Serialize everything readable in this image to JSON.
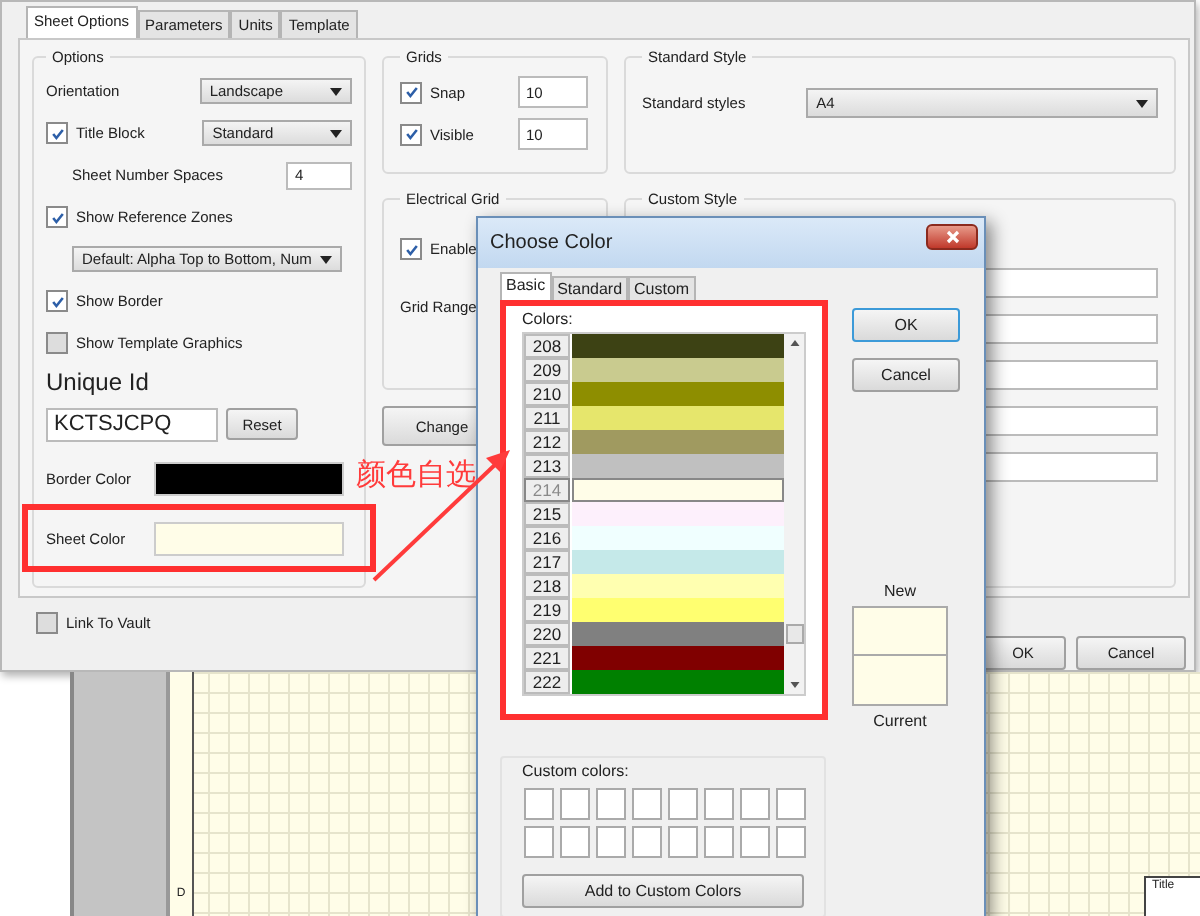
{
  "main_dialog": {
    "tabs": [
      {
        "label": "Sheet Options",
        "selected": true
      },
      {
        "label": "Parameters",
        "selected": false
      },
      {
        "label": "Units",
        "selected": false
      },
      {
        "label": "Template",
        "selected": false
      }
    ],
    "options": {
      "title": "Options",
      "items": [
        {
          "kind": "dropdown",
          "label": "Orientation",
          "value": "Landscape"
        },
        {
          "kind": "check-dropdown",
          "label": "Title Block",
          "checked": true,
          "value": "Standard"
        },
        {
          "kind": "number",
          "label": "Sheet Number Spaces",
          "value": "4"
        },
        {
          "kind": "checkbox",
          "label": "Show Reference Zones",
          "checked": true
        },
        {
          "kind": "select",
          "value": "Default: Alpha Top to Bottom, Num"
        },
        {
          "kind": "checkbox",
          "label": "Show Border",
          "checked": true
        },
        {
          "kind": "checkbox",
          "label": "Show Template Graphics",
          "checked": false
        },
        {
          "kind": "heading",
          "label": "Unique Id"
        },
        {
          "kind": "id",
          "value": "KCTSJCPQ",
          "button": "Reset"
        },
        {
          "kind": "color",
          "label": "Border Color",
          "color": "#000000",
          "highlighted": false
        },
        {
          "kind": "color",
          "label": "Sheet Color",
          "color": "#fffde8",
          "highlighted": true
        }
      ]
    },
    "grids": {
      "title": "Grids",
      "items": [
        {
          "label": "Snap",
          "checked": true,
          "value": "10"
        },
        {
          "label": "Visible",
          "checked": true,
          "value": "10"
        }
      ]
    },
    "electrical_grid": {
      "title": "Electrical Grid",
      "enable": {
        "label": "Enable",
        "checked": true
      },
      "range_label": "Grid Range"
    },
    "change_button": "Change",
    "standard_style": {
      "title": "Standard Style",
      "label": "Standard styles",
      "value": "A4"
    },
    "custom_style": {
      "title": "Custom Style"
    },
    "link_to_vault": {
      "label": "Link To Vault",
      "checked": false
    },
    "buttons": [
      "OK",
      "Cancel"
    ]
  },
  "color_dialog": {
    "title": "Choose Color",
    "tabs": [
      {
        "label": "Basic",
        "selected": true
      },
      {
        "label": "Standard",
        "selected": false
      },
      {
        "label": "Custom",
        "selected": false
      }
    ],
    "colors_label": "Colors:",
    "highlighted": true,
    "colors": [
      {
        "number": "208",
        "color": "#3d4214",
        "selected": false
      },
      {
        "number": "209",
        "color": "#c9cb8f",
        "selected": false
      },
      {
        "number": "210",
        "color": "#8e8e00",
        "selected": false
      },
      {
        "number": "211",
        "color": "#e6e66c",
        "selected": false
      },
      {
        "number": "212",
        "color": "#a09a60",
        "selected": false
      },
      {
        "number": "213",
        "color": "#c0c0c0",
        "selected": false
      },
      {
        "number": "214",
        "color": "#fffde8",
        "selected": true
      },
      {
        "number": "215",
        "color": "#fdf0fc",
        "selected": false
      },
      {
        "number": "216",
        "color": "#f0ffff",
        "selected": false
      },
      {
        "number": "217",
        "color": "#c5e9e9",
        "selected": false
      },
      {
        "number": "218",
        "color": "#ffffb0",
        "selected": false
      },
      {
        "number": "219",
        "color": "#ffff70",
        "selected": false
      },
      {
        "number": "220",
        "color": "#808080",
        "selected": false
      },
      {
        "number": "221",
        "color": "#800000",
        "selected": false
      },
      {
        "number": "222",
        "color": "#008000",
        "selected": false
      }
    ],
    "buttons": [
      "OK",
      "Cancel"
    ],
    "new_label": "New",
    "current_label": "Current",
    "custom_colors_label": "Custom colors:",
    "add_button": "Add to Custom Colors"
  },
  "annotation": {
    "label": "颜色自选"
  },
  "drawing": {
    "zone_label": "D",
    "title_label": "Title"
  }
}
